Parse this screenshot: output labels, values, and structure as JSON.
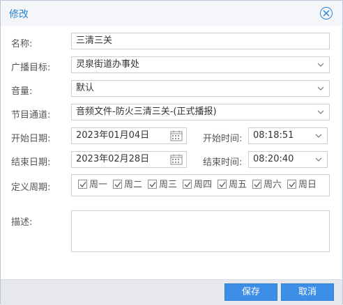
{
  "dialog": {
    "title": "修改"
  },
  "form": {
    "name": {
      "label": "名称:",
      "value": "三清三关"
    },
    "target": {
      "label": "广播目标:",
      "value": "灵泉街道办事处"
    },
    "volume": {
      "label": "音量:",
      "value": "默认"
    },
    "channel": {
      "label": "节目通道:",
      "value": "音频文件-防火三清三关-(正式播报)"
    },
    "start_date": {
      "label": "开始日期:",
      "value": "2023年01月04日"
    },
    "start_time": {
      "label": "开始时间:",
      "value": "08:18:51"
    },
    "end_date": {
      "label": "结束日期:",
      "value": "2023年02月28日"
    },
    "end_time": {
      "label": "结束时间:",
      "value": "08:20:40"
    },
    "period": {
      "label": "定义周期:",
      "days": [
        {
          "label": "周一",
          "checked": true
        },
        {
          "label": "周二",
          "checked": true
        },
        {
          "label": "周三",
          "checked": true
        },
        {
          "label": "周四",
          "checked": true
        },
        {
          "label": "周五",
          "checked": true
        },
        {
          "label": "周六",
          "checked": true
        },
        {
          "label": "周日",
          "checked": true
        }
      ]
    },
    "description": {
      "label": "描述:",
      "value": ""
    }
  },
  "footer": {
    "save_label": "保存",
    "cancel_label": "取消"
  },
  "colors": {
    "accent": "#2a86d6",
    "button": "#3c8ee6",
    "footer_bg": "#e6e8eb"
  },
  "icons": [
    "close-icon",
    "chevron-down-icon",
    "calendar-icon",
    "checkbox-checked-icon"
  ]
}
